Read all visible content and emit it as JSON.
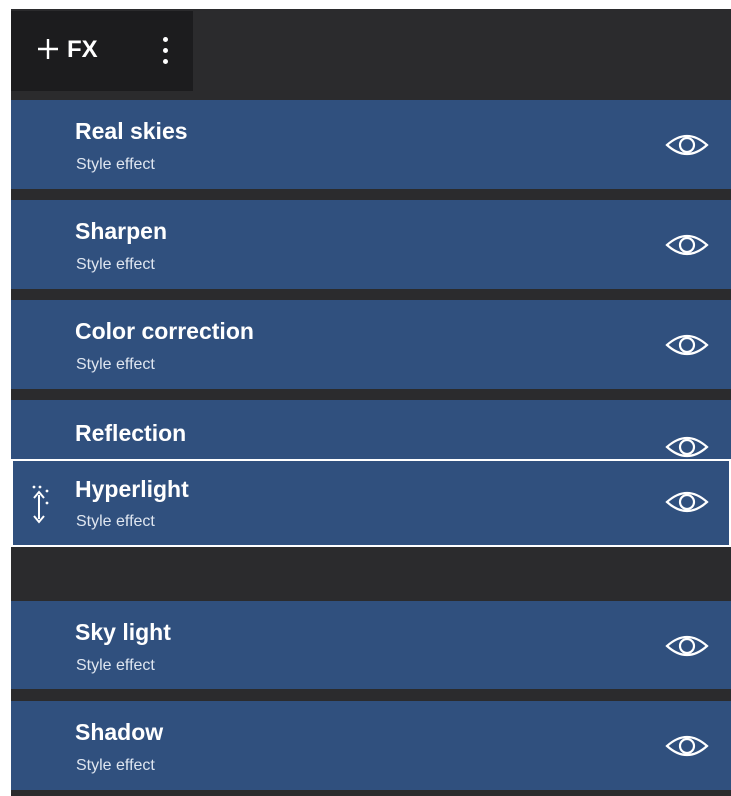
{
  "toolbar": {
    "add_icon": "plus-icon",
    "fx_label": "FX",
    "more_icon": "vertical-ellipsis-icon"
  },
  "colors": {
    "panel_bg": "#2b2b2d",
    "toolbar_bg": "#1c1c1e",
    "row_bg": "#30507e",
    "text": "#ffffff",
    "drag_border": "#ffffff"
  },
  "effects": [
    {
      "title": "Real skies",
      "subtitle": "Style effect",
      "visibility_icon": "eye-icon"
    },
    {
      "title": "Sharpen",
      "subtitle": "Style effect",
      "visibility_icon": "eye-icon"
    },
    {
      "title": "Color correction",
      "subtitle": "Style effect",
      "visibility_icon": "eye-icon"
    },
    {
      "title": "Reflection",
      "subtitle": "",
      "visibility_icon": "eye-icon"
    },
    {
      "title": "Hyperlight",
      "subtitle": "Style effect",
      "visibility_icon": "eye-icon",
      "state": "dragging",
      "handle_icon": "drag-handle-icon"
    },
    {
      "title": "Sky light",
      "subtitle": "Style effect",
      "visibility_icon": "eye-icon"
    },
    {
      "title": "Shadow",
      "subtitle": "Style effect",
      "visibility_icon": "eye-icon"
    }
  ]
}
